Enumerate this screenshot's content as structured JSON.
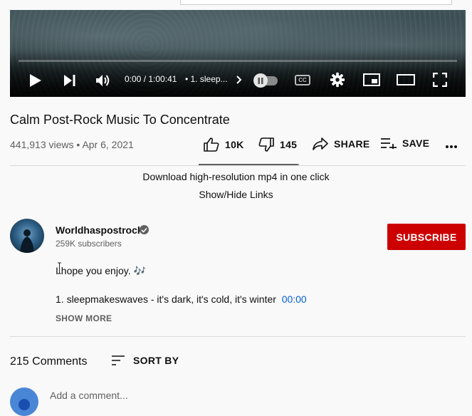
{
  "player": {
    "time_current": "0:00",
    "time_separator": " / ",
    "time_total": "1:00:41",
    "chapter_label": "• 1. sleep...",
    "progress_percent": 0,
    "autoplay_on": false,
    "cc_label": "CC",
    "icons": [
      "play-icon",
      "next-icon",
      "volume-icon",
      "chevron-right-icon",
      "pause-icon",
      "cc-icon",
      "gear-icon",
      "miniplayer-icon",
      "theater-icon",
      "fullscreen-icon"
    ]
  },
  "video": {
    "title": "Calm Post-Rock Music To Concentrate",
    "views": "441,913 views",
    "date_separator": " • ",
    "date": "Apr 6, 2021"
  },
  "actions": {
    "like_count": "10K",
    "dislike_count": "145",
    "share_label": "SHARE",
    "save_label": "SAVE",
    "more_icon": "more-vert-icon",
    "like_ratio": 0.986
  },
  "plugin": {
    "download_text": "Download high-resolution mp4 in one click",
    "toggle_text": "Show/Hide Links"
  },
  "channel": {
    "name": "Worldhaspostrock",
    "subscribers": "259K subscribers",
    "subscribe_label": "SUBSCRIBE"
  },
  "description": {
    "line1": "I hope you enjoy. ",
    "line1_emoji": "🎶",
    "track_text": "1. sleepmakeswaves - it's dark, it's cold, it's winter",
    "track_timestamp": "00:00",
    "show_more": "SHOW MORE"
  },
  "comments": {
    "count_text": "215 Comments",
    "sort_label": "SORT BY",
    "placeholder": "Add a comment..."
  },
  "colors": {
    "accent_red": "#cc0000",
    "link_blue": "#065fd4",
    "secondary_text": "#606060",
    "background": "#f9f9f9"
  }
}
